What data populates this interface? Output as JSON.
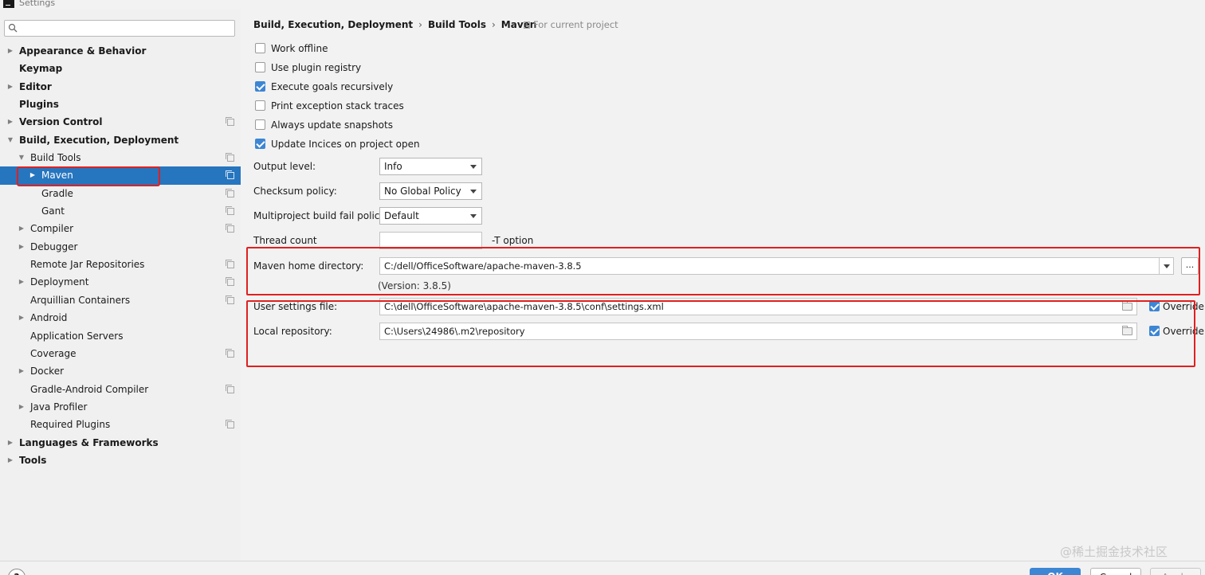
{
  "window": {
    "title": "Settings"
  },
  "search": {
    "placeholder": "",
    "icon": "search-icon"
  },
  "tree": [
    {
      "label": "Appearance & Behavior",
      "bold": true,
      "indent": 0,
      "arrow": "right",
      "copy": false
    },
    {
      "label": "Keymap",
      "bold": true,
      "indent": 0,
      "arrow": "",
      "copy": false
    },
    {
      "label": "Editor",
      "bold": true,
      "indent": 0,
      "arrow": "right",
      "copy": false
    },
    {
      "label": "Plugins",
      "bold": true,
      "indent": 0,
      "arrow": "",
      "copy": false
    },
    {
      "label": "Version Control",
      "bold": true,
      "indent": 0,
      "arrow": "right",
      "copy": true
    },
    {
      "label": "Build, Execution, Deployment",
      "bold": true,
      "indent": 0,
      "arrow": "down",
      "copy": false
    },
    {
      "label": "Build Tools",
      "bold": false,
      "indent": 1,
      "arrow": "down",
      "copy": true
    },
    {
      "label": "Maven",
      "bold": false,
      "indent": 2,
      "arrow": "right",
      "copy": true,
      "selected": true
    },
    {
      "label": "Gradle",
      "bold": false,
      "indent": 2,
      "arrow": "",
      "copy": true
    },
    {
      "label": "Gant",
      "bold": false,
      "indent": 2,
      "arrow": "",
      "copy": true
    },
    {
      "label": "Compiler",
      "bold": false,
      "indent": 1,
      "arrow": "right",
      "copy": true
    },
    {
      "label": "Debugger",
      "bold": false,
      "indent": 1,
      "arrow": "right",
      "copy": false
    },
    {
      "label": "Remote Jar Repositories",
      "bold": false,
      "indent": 1,
      "arrow": "",
      "copy": true
    },
    {
      "label": "Deployment",
      "bold": false,
      "indent": 1,
      "arrow": "right",
      "copy": true
    },
    {
      "label": "Arquillian Containers",
      "bold": false,
      "indent": 1,
      "arrow": "",
      "copy": true
    },
    {
      "label": "Android",
      "bold": false,
      "indent": 1,
      "arrow": "right",
      "copy": false
    },
    {
      "label": "Application Servers",
      "bold": false,
      "indent": 1,
      "arrow": "",
      "copy": false
    },
    {
      "label": "Coverage",
      "bold": false,
      "indent": 1,
      "arrow": "",
      "copy": true
    },
    {
      "label": "Docker",
      "bold": false,
      "indent": 1,
      "arrow": "right",
      "copy": false
    },
    {
      "label": "Gradle-Android Compiler",
      "bold": false,
      "indent": 1,
      "arrow": "",
      "copy": true
    },
    {
      "label": "Java Profiler",
      "bold": false,
      "indent": 1,
      "arrow": "right",
      "copy": false
    },
    {
      "label": "Required Plugins",
      "bold": false,
      "indent": 1,
      "arrow": "",
      "copy": true
    },
    {
      "label": "Languages & Frameworks",
      "bold": true,
      "indent": 0,
      "arrow": "right",
      "copy": false
    },
    {
      "label": "Tools",
      "bold": true,
      "indent": 0,
      "arrow": "right",
      "copy": false
    }
  ],
  "breadcrumb": {
    "part1": "Build, Execution, Deployment",
    "part2": "Build Tools",
    "part3": "Maven",
    "scope": "For current project"
  },
  "checkboxes": [
    {
      "label": "Work offline",
      "checked": false
    },
    {
      "label": "Use plugin registry",
      "checked": false
    },
    {
      "label": "Execute goals recursively",
      "checked": true
    },
    {
      "label": "Print exception stack traces",
      "checked": false
    },
    {
      "label": "Always update snapshots",
      "checked": false
    },
    {
      "label": "Update Incices on project open",
      "checked": true
    }
  ],
  "form": {
    "output_level_label": "Output level:",
    "output_level_value": "Info",
    "checksum_label": "Checksum policy:",
    "checksum_value": "No Global Policy",
    "multiproject_label": "Multiproject build fail policy:",
    "multiproject_value": "Default",
    "thread_label": "Thread count",
    "thread_value": "",
    "t_option": "-T option",
    "maven_home_label": "Maven home directory:",
    "maven_home_value": "C:/dell/OfficeSoftware/apache-maven-3.8.5",
    "browse_label": "...",
    "version_text": "(Version: 3.8.5)",
    "user_settings_label": "User settings file:",
    "user_settings_value": "C:\\dell\\OfficeSoftware\\apache-maven-3.8.5\\conf\\settings.xml",
    "local_repo_label": "Local repository:",
    "local_repo_value": "C:\\Users\\24986\\.m2\\repository",
    "override_label": "Override",
    "override_checked": true
  },
  "buttons": {
    "help": "?",
    "ok": "OK",
    "cancel": "Cancel",
    "apply": "Apply"
  },
  "watermark": "@稀土掘金技术社区",
  "colors": {
    "selection": "#2675bf",
    "accent": "#3c86d4",
    "highlight": "#e02020"
  }
}
